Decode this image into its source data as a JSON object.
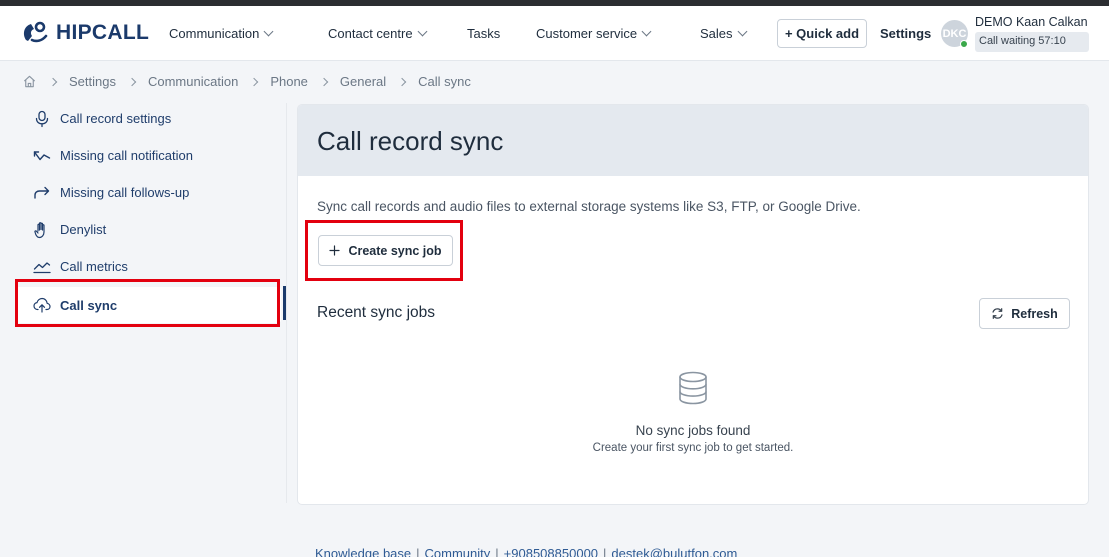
{
  "brand": {
    "name": "HIPCALL",
    "color": "#1b3a6b"
  },
  "nav": {
    "items": [
      {
        "label": "Communication",
        "has_dropdown": true
      },
      {
        "label": "Contact centre",
        "has_dropdown": true
      },
      {
        "label": "Tasks",
        "has_dropdown": false
      },
      {
        "label": "Customer service",
        "has_dropdown": true
      },
      {
        "label": "Sales",
        "has_dropdown": true
      }
    ],
    "quick_add": "+ Quick add",
    "settings": "Settings",
    "user": {
      "initials": "DKC",
      "name": "DEMO Kaan Calkan",
      "status": "Call waiting 57:10",
      "presence_color": "#3aa84a"
    }
  },
  "breadcrumb": [
    "Settings",
    "Communication",
    "Phone",
    "General",
    "Call sync"
  ],
  "sidebar": {
    "items": [
      {
        "label": "Call record settings",
        "icon": "microphone-icon"
      },
      {
        "label": "Missing call notification",
        "icon": "missed-call-icon"
      },
      {
        "label": "Missing call follows-up",
        "icon": "forward-arrow-icon"
      },
      {
        "label": "Denylist",
        "icon": "hand-icon"
      },
      {
        "label": "Call metrics",
        "icon": "chart-line-icon"
      },
      {
        "label": "Call sync",
        "icon": "cloud-upload-icon",
        "active": true
      }
    ]
  },
  "main": {
    "title": "Call record sync",
    "description": "Sync call records and audio files to external storage systems like S3, FTP, or Google Drive.",
    "create_button": "Create sync job",
    "recent_title": "Recent sync jobs",
    "refresh_button": "Refresh",
    "empty": {
      "title": "No sync jobs found",
      "subtitle": "Create your first sync job to get started."
    }
  },
  "footer": {
    "links": [
      "Knowledge base",
      "Community",
      "+908508850000",
      "destek@bulutfon.com"
    ]
  },
  "highlight_color": "#e3000f"
}
